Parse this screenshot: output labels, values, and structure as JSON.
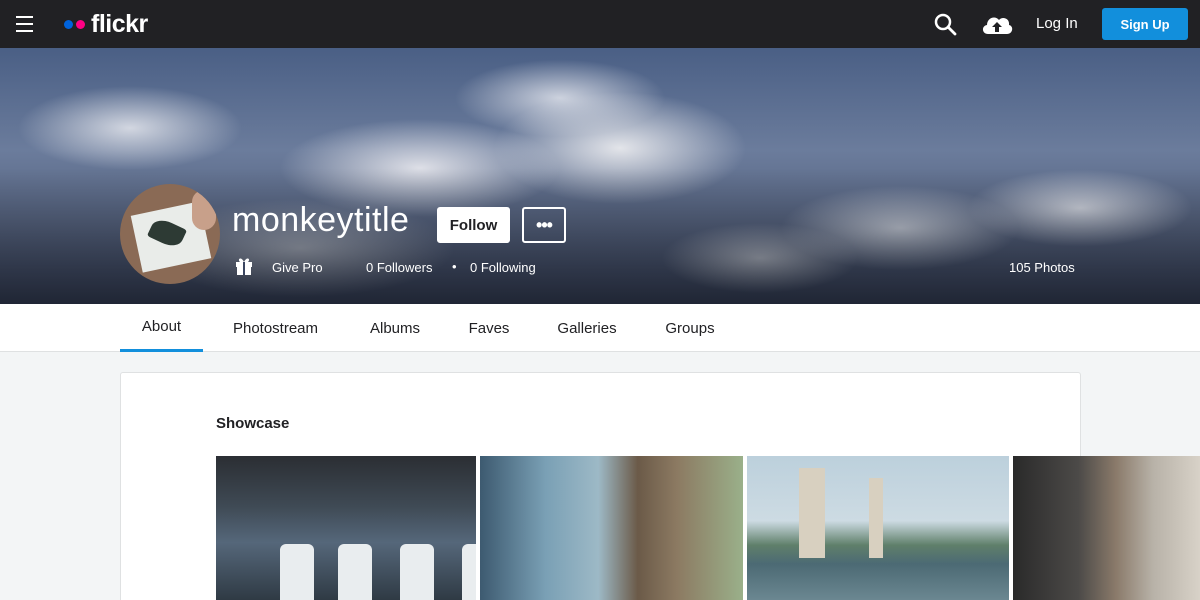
{
  "topbar": {
    "logo_text": "flickr",
    "logo_dot_colors": [
      "#0063dc",
      "#ff0084"
    ],
    "login_label": "Log In",
    "signup_label": "Sign Up",
    "accent": "#128fdc",
    "icons": [
      "menu-icon",
      "search-icon",
      "upload-cloud-icon"
    ]
  },
  "profile": {
    "username": "monkeytitle",
    "follow_label": "Follow",
    "more_label": "•••",
    "give_pro_label": "Give Pro",
    "followers_label": "0 Followers",
    "separator": "•",
    "following_label": "0 Following",
    "photos_label": "105 Photos"
  },
  "nav": {
    "tabs": [
      {
        "label": "About",
        "active": true
      },
      {
        "label": "Photostream",
        "active": false
      },
      {
        "label": "Albums",
        "active": false
      },
      {
        "label": "Faves",
        "active": false
      },
      {
        "label": "Galleries",
        "active": false
      },
      {
        "label": "Groups",
        "active": false
      }
    ]
  },
  "main": {
    "showcase_title": "Showcase"
  }
}
